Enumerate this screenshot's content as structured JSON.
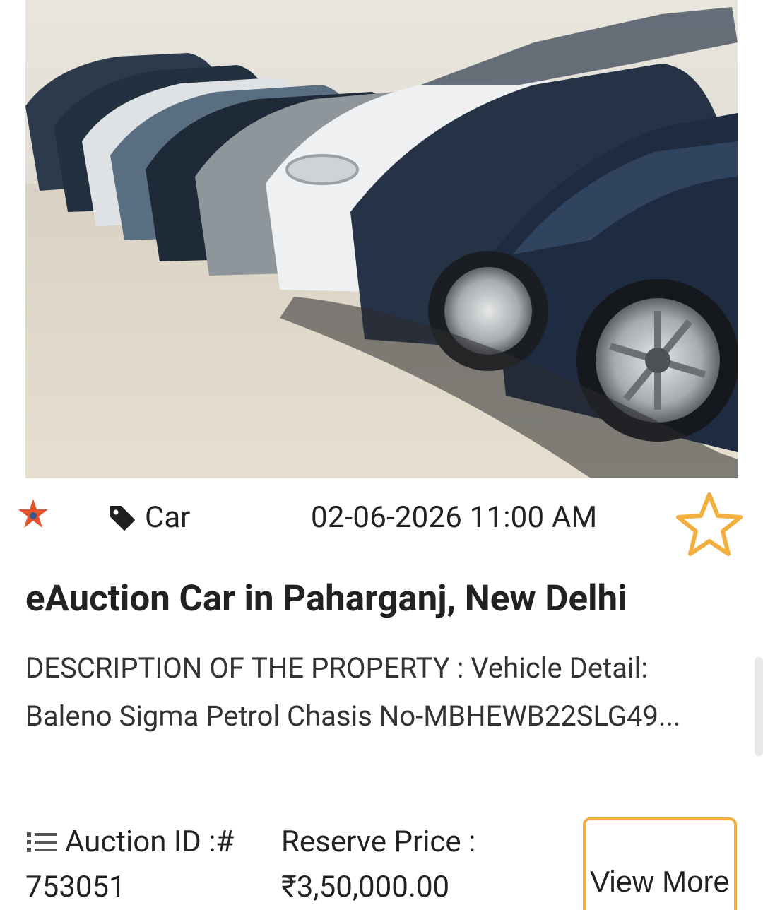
{
  "listing": {
    "image_alt": "Row of parked cars",
    "category": "Car",
    "date_time": "02-06-2026 11:00 AM",
    "title": "eAuction Car in Paharganj, New Delhi",
    "description": "DESCRIPTION OF THE PROPERTY : Vehicle Detail: Baleno Sigma Petrol Chasis No-MBHEWB22SLG49...",
    "auction_id_label": "Auction ID :#",
    "auction_id_value": "753051",
    "reserve_price_label": "Reserve Price :",
    "reserve_price_value": "₹3,50,000.00",
    "view_more_label": "View More"
  },
  "icons": {
    "brand": "emblem-star-icon",
    "category": "tag-icon",
    "favorite": "star-outline-icon",
    "auction_id": "list-icon"
  },
  "colors": {
    "accent": "#f2ae3e",
    "brand_star": "#e2542c",
    "text": "#222222"
  }
}
